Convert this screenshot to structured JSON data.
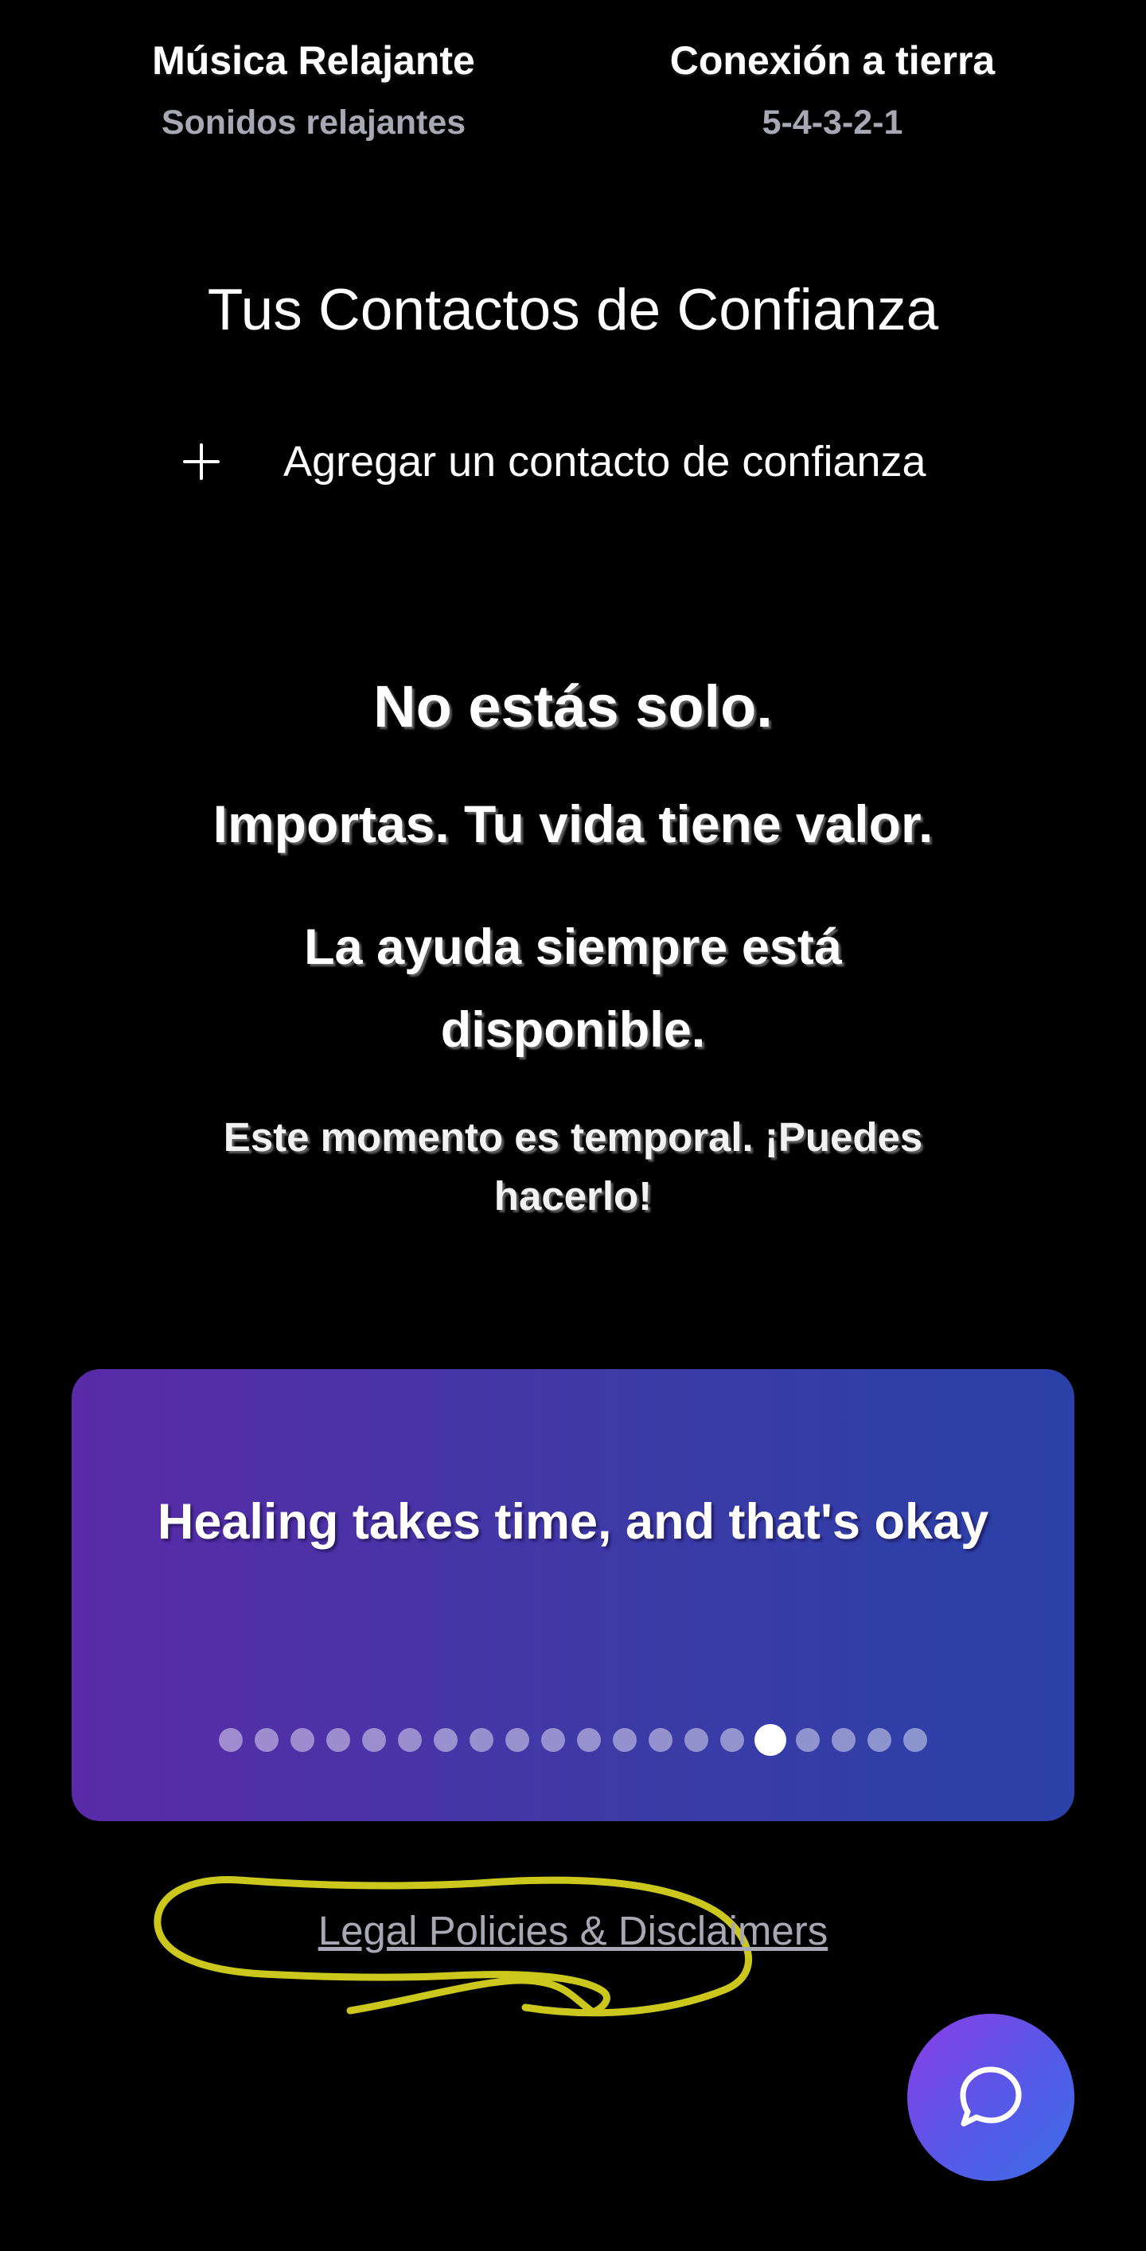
{
  "tools": [
    {
      "title": "Música Relajante",
      "subtitle": "Sonidos relajantes"
    },
    {
      "title": "Conexión a tierra",
      "subtitle": "5-4-3-2-1"
    }
  ],
  "contacts": {
    "title": "Tus Contactos de Confianza",
    "add_label": "Agregar un contacto de confianza"
  },
  "affirmations": [
    "No estás solo.",
    "Importas. Tu vida tiene valor.",
    "La ayuda siempre está disponible.",
    "Este momento es temporal. ¡Puedes hacerlo!"
  ],
  "quote_card": {
    "text": "Healing takes time, and that's okay",
    "dot_count": 20,
    "active_index": 15
  },
  "legal": {
    "link_label": "Legal Policies & Disclaimers"
  },
  "chat": {
    "icon": "chat-bubble-icon"
  },
  "colors": {
    "background": "#000000",
    "card_gradient_start": "#5a2aa8",
    "card_gradient_end": "#2a41a8",
    "muted_text": "#a7a8b3",
    "annotation": "#d6d21e",
    "chat_gradient_start": "#8c3ee6",
    "chat_gradient_end": "#3b6fe6"
  }
}
